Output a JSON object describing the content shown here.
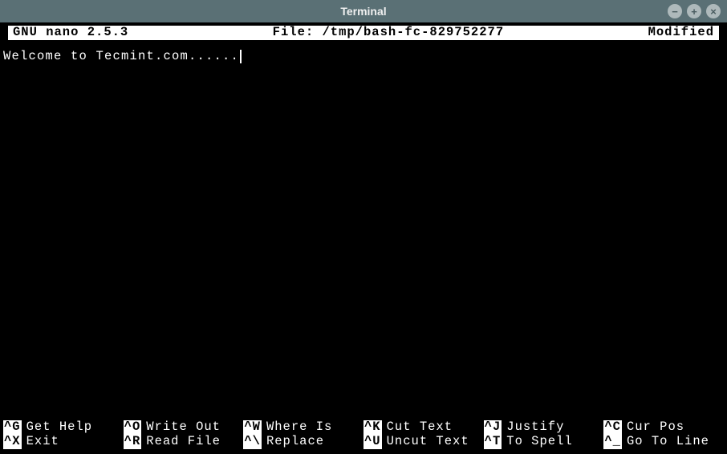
{
  "window": {
    "title": "Terminal",
    "controls": {
      "minimize": "−",
      "maximize": "+",
      "close": "×"
    }
  },
  "nano": {
    "header": {
      "left": "GNU nano 2.5.3",
      "center": "File: /tmp/bash-fc-829752277",
      "right": "Modified"
    },
    "content": "Welcome to Tecmint.com......",
    "shortcuts": [
      {
        "key": "^G",
        "label": "Get Help"
      },
      {
        "key": "^O",
        "label": "Write Out"
      },
      {
        "key": "^W",
        "label": "Where Is"
      },
      {
        "key": "^K",
        "label": "Cut Text"
      },
      {
        "key": "^J",
        "label": "Justify"
      },
      {
        "key": "^C",
        "label": "Cur Pos"
      },
      {
        "key": "^X",
        "label": "Exit"
      },
      {
        "key": "^R",
        "label": "Read File"
      },
      {
        "key": "^\\",
        "label": "Replace"
      },
      {
        "key": "^U",
        "label": "Uncut Text"
      },
      {
        "key": "^T",
        "label": "To Spell"
      },
      {
        "key": "^_",
        "label": "Go To Line"
      }
    ]
  }
}
